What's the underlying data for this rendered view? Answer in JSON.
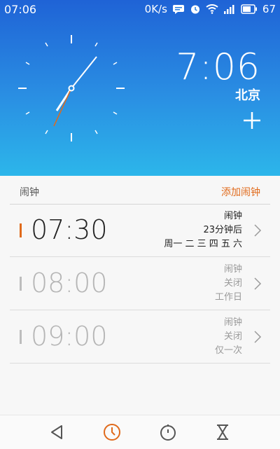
{
  "status_bar": {
    "time": "07:06",
    "network_speed": "0K/s",
    "battery": "67",
    "icons": [
      "message-icon",
      "alarm-icon",
      "wifi-icon",
      "signal-icon",
      "battery-icon"
    ]
  },
  "world_clock": {
    "time": "7:06",
    "city": "北京"
  },
  "alarms_section": {
    "title": "闹钟",
    "add_label": "添加闹钟"
  },
  "alarms": [
    {
      "time": "07:30",
      "label": "闹钟",
      "status": "23分钟后",
      "repeat": "周一 二 三 四 五 六",
      "enabled": true
    },
    {
      "time": "08:00",
      "label": "闹钟",
      "status": "关闭",
      "repeat": "工作日",
      "enabled": false
    },
    {
      "time": "09:00",
      "label": "闹钟",
      "status": "关闭",
      "repeat": "仅一次",
      "enabled": false
    }
  ],
  "bottom_nav": [
    "back-icon",
    "clock-icon",
    "stopwatch-icon",
    "timer-icon"
  ],
  "colors": {
    "accent": "#e06a1b",
    "header_top": "#1f63d6",
    "header_bottom": "#2cb6ea"
  }
}
